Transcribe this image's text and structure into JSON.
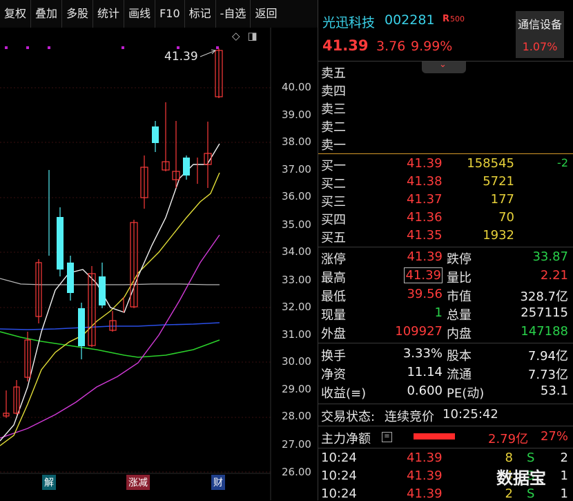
{
  "toolbar": {
    "items": [
      "复权",
      "叠加",
      "多股",
      "统计",
      "画线",
      "F10",
      "标记",
      "-自选",
      "返回"
    ]
  },
  "chart": {
    "last_price_label": "41.39",
    "y_labels": [
      "40.00",
      "39.00",
      "38.00",
      "37.00",
      "36.00",
      "35.00",
      "34.00",
      "33.00",
      "32.00",
      "31.00",
      "30.00",
      "29.00",
      "28.00",
      "27.00",
      "26.00"
    ],
    "badges": {
      "jie": "解",
      "zd": "涨减",
      "cai": "财"
    },
    "icons": [
      "diamond-icon",
      "panel-toggle-icon"
    ]
  },
  "header": {
    "name": "光迅科技",
    "code": "002281",
    "tag": "R",
    "tag_sub": "500",
    "price": "41.39",
    "change": "3.76",
    "change_pct": "9.99%",
    "sector": "通信设备",
    "sector_pct": "1.07%"
  },
  "sell": [
    {
      "label": "卖五",
      "price": "",
      "vol": "",
      "chg": ""
    },
    {
      "label": "卖四",
      "price": "",
      "vol": "",
      "chg": ""
    },
    {
      "label": "卖三",
      "price": "",
      "vol": "",
      "chg": ""
    },
    {
      "label": "卖二",
      "price": "",
      "vol": "",
      "chg": ""
    },
    {
      "label": "卖一",
      "price": "",
      "vol": "",
      "chg": ""
    }
  ],
  "buy": [
    {
      "label": "买一",
      "price": "41.39",
      "vol": "158545",
      "chg": "-2"
    },
    {
      "label": "买二",
      "price": "41.38",
      "vol": "5721",
      "chg": ""
    },
    {
      "label": "买三",
      "price": "41.37",
      "vol": "177",
      "chg": ""
    },
    {
      "label": "买四",
      "price": "41.36",
      "vol": "70",
      "chg": ""
    },
    {
      "label": "买五",
      "price": "41.35",
      "vol": "1932",
      "chg": ""
    }
  ],
  "stats": {
    "limit_up_label": "涨停",
    "limit_up": "41.39",
    "limit_down_label": "跌停",
    "limit_down": "33.87",
    "high_label": "最高",
    "high": "41.39",
    "vol_ratio_label": "量比",
    "vol_ratio": "2.21",
    "low_label": "最低",
    "low": "39.56",
    "mkt_cap_label": "市值",
    "mkt_cap": "328.7亿",
    "cur_vol_label": "现量",
    "cur_vol": "1",
    "total_vol_label": "总量",
    "total_vol": "257115",
    "outer_label": "外盘",
    "outer": "109927",
    "inner_label": "内盘",
    "inner": "147188",
    "turnover_label": "换手",
    "turnover": "3.33%",
    "shares_label": "股本",
    "shares": "7.94亿",
    "net_asset_label": "净资",
    "net_asset": "11.14",
    "float_label": "流通",
    "float": "7.73亿",
    "eps_label": "收益(≡)",
    "eps": "0.600",
    "pe_label": "PE(动)",
    "pe": "53.1"
  },
  "trade_status": {
    "label": "交易状态:",
    "status": "连续竞价",
    "time": "10:25:42"
  },
  "main_flow": {
    "label": "主力净额",
    "value": "2.79亿",
    "pct": "27%"
  },
  "ticks": [
    {
      "time": "10:24",
      "price": "41.39",
      "vol": "8",
      "side": "S",
      "count": "2"
    },
    {
      "time": "10:24",
      "price": "41.39",
      "vol": "4",
      "side": "S",
      "count": "1"
    },
    {
      "time": "10:24",
      "price": "41.39",
      "vol": "2",
      "side": "S",
      "count": "1"
    }
  ],
  "watermark": "数据宝",
  "colors": {
    "up": "#ff3b3b",
    "down": "#29d14a",
    "cyan_candle": "#54f0f6",
    "ma5": "#f2f2f2",
    "ma10": "#e3df38",
    "ma20": "#d23ad8",
    "ma60": "#2a4ee6",
    "ma120": "#2bd12b",
    "ma250": "#b8b8b8"
  }
}
